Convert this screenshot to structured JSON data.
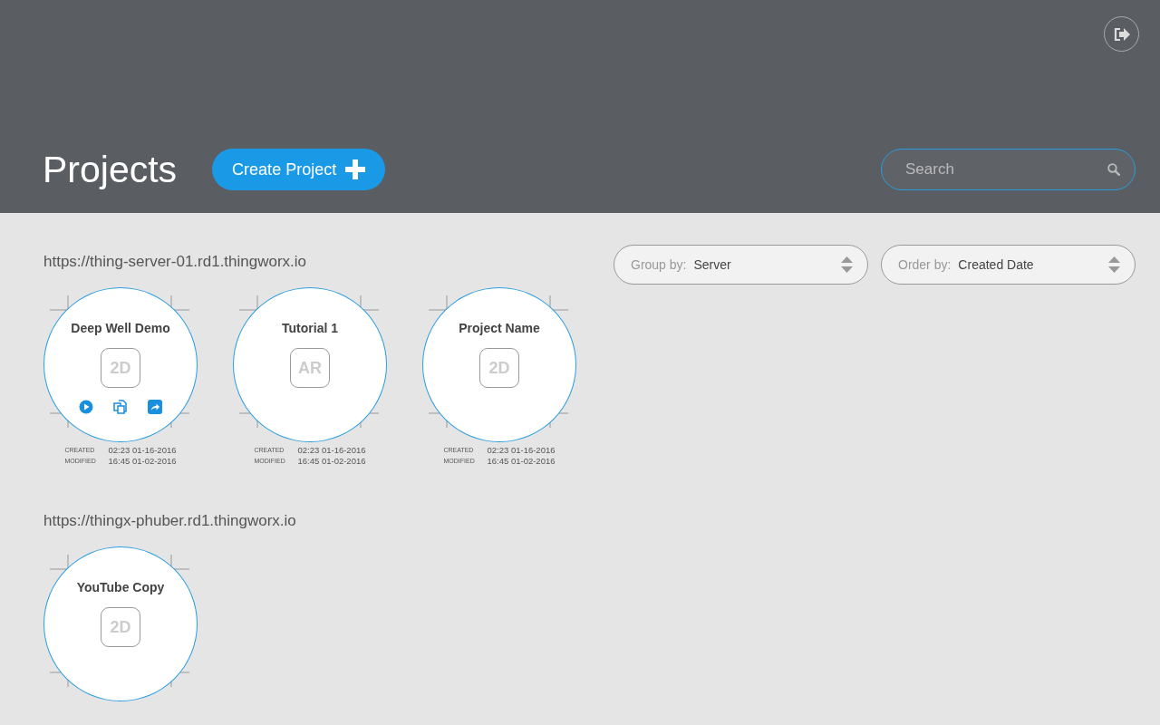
{
  "header": {
    "title": "Projects",
    "create_button": {
      "label": "Create Project"
    },
    "search": {
      "placeholder": "Search"
    }
  },
  "filters": [
    {
      "label": "Group by:",
      "value": "Server"
    },
    {
      "label": "Order by:",
      "value": "Created Date"
    }
  ],
  "groups": [
    {
      "server": "https://thing-server-01.rd1.thingworx.io",
      "projects": [
        {
          "name": "Deep Well Demo",
          "type": "2D",
          "show_actions": true,
          "created_label": "CREATED",
          "created": "02:23 01-16-2016",
          "modified_label": "MODIFIED",
          "modified": "16:45 01-02-2016"
        },
        {
          "name": "Tutorial 1",
          "type": "AR",
          "show_actions": false,
          "created_label": "CREATED",
          "created": "02:23 01-16-2016",
          "modified_label": "MODIFIED",
          "modified": "16:45 01-02-2016"
        },
        {
          "name": "Project Name",
          "type": "2D",
          "show_actions": false,
          "created_label": "CREATED",
          "created": "02:23 01-16-2016",
          "modified_label": "MODIFIED",
          "modified": "16:45 01-02-2016"
        }
      ]
    },
    {
      "server": "https://thingx-phuber.rd1.thingworx.io",
      "projects": [
        {
          "name": "YouTube Copy",
          "type": "2D",
          "show_actions": false
        }
      ]
    }
  ]
}
